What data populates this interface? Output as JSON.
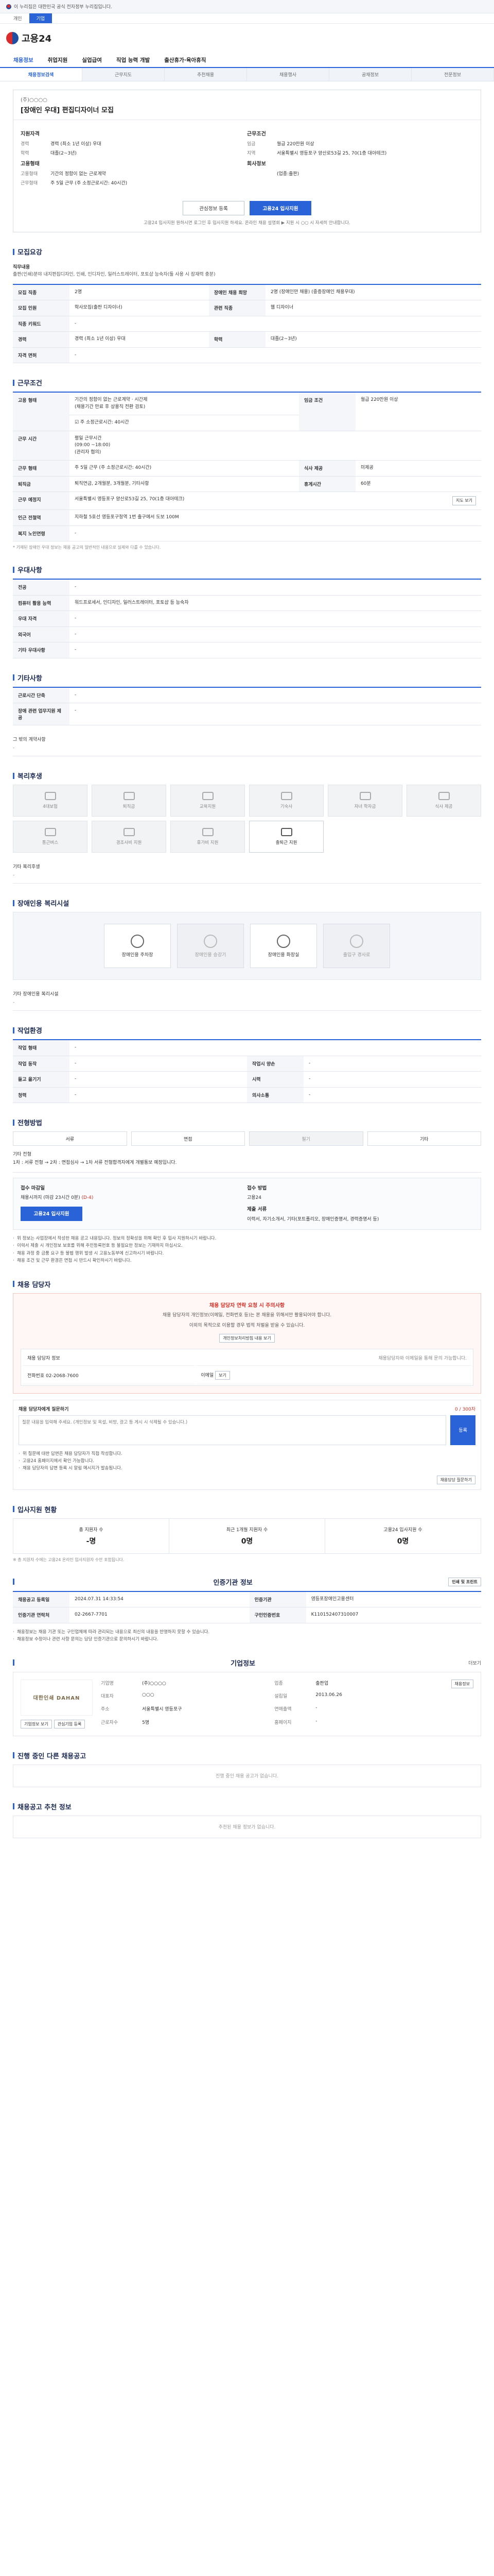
{
  "gov_bar": {
    "text": "이 누리집은 대한민국 공식 전자정부 누리집입니다."
  },
  "top_tabs": [
    "개인",
    "기업"
  ],
  "logo": {
    "text": "고용24"
  },
  "gnb": [
    "채용정보",
    "취업지원",
    "실업급여",
    "직업 능력 개발",
    "출산휴가·육아휴직"
  ],
  "subnav": [
    "채용정보검색",
    "근무지도",
    "추천채용",
    "채용행사",
    "공채정보",
    "전문정보"
  ],
  "job": {
    "company": "(주)○○○○",
    "title": "[장애인 우대] 편집디자이너 모집",
    "left_title": "지원자격",
    "left": [
      {
        "k": "경력",
        "v": "경력 (최소 1년 이상) 우대"
      },
      {
        "k": "학력",
        "v": "대졸(2~3년)"
      }
    ],
    "right_title": "근무조건",
    "right": [
      {
        "k": "임금",
        "v": "월급 220만원 이상"
      },
      {
        "k": "지역",
        "v": "서울특별시 영등포구 양산로53길 25, 70(1층 대아테크)"
      }
    ],
    "left_title2": "고용형태",
    "left2": [
      {
        "k": "고용형태",
        "v": "기간의 정함이 없는 근로계약"
      },
      {
        "k": "근무형태",
        "v": "주 5일 근무 (주 소정근로시간: 40시간)"
      }
    ],
    "right_title2": "회사정보",
    "right2": [
      {
        "k": "",
        "v": "(업종:출판)"
      }
    ],
    "btn_scrap": "관심정보 등록",
    "btn_apply": "고용24 입사지원",
    "notice": "고용24 입사지원 원하시면 로그인 후 입사지원 하세요. 온라인 채용 설명회 ▶ 지원 시 ○○ 시 자세히 안내합니다."
  },
  "recruit": {
    "title": "모집요강",
    "desc_head": "직무내용",
    "desc": "출판(인쇄)분야 내지편집디자인, 인쇄, 인디자인, 일러스트레이터, 포토샵 능숙자(툴 사용 시 잠재력 충분)",
    "rows": [
      [
        "모집 직종",
        "2명",
        "장애인 채용 희망",
        "2명 (장애인만 채용) (중증장애인 채용우대)"
      ],
      [
        "모집 인원",
        "학사모집(출판 디자이너)",
        "관련 직종",
        "웹 디자이너"
      ],
      [
        "직종 키워드",
        "-",
        "",
        ""
      ],
      [
        "경력",
        "경력 (최소 1년 이상) 우대",
        "학력",
        "대졸(2~3년)"
      ],
      [
        "자격 면허",
        "-",
        "",
        ""
      ]
    ]
  },
  "conditions": {
    "title": "근무조건",
    "rows": [
      [
        "고용 형태",
        "기간의 정함이 없는 근로계약 · 시간제\n(채용기간 만료 후 상용직 전환 검토)",
        "임금 조건",
        "월급 220만원 이상"
      ],
      [
        "",
        "☑ 주 소정근로시간: 40시간",
        "",
        ""
      ],
      [
        "근무 시간",
        "평일 근무시간\n(09:00 ~18:00)\n(관리자 협의)",
        "",
        ""
      ],
      [
        "퇴직금",
        "퇴직연금, 2개월분, 3개월분, 기타사항",
        "휴게시간",
        "60분"
      ],
      [
        "근무 예정지",
        "서울특별시 영등포구 양산로53길 25, 70(1층 대아테크)",
        "",
        ""
      ],
      [
        "인근 전철역",
        "지하철 5호선 영등포구청역 1번 출구에서 도보 100M",
        "",
        ""
      ],
      [
        "복지 노인연령",
        "-",
        "",
        ""
      ]
    ],
    "sub_rows": [
      [
        "근무 형태",
        "주 5일 근무 (주 소정근로시간: 40시간)",
        "식사 제공",
        "미제공"
      ]
    ],
    "note": "* 기재된 장애인 우대 정보는 채용 공고의 일반적인 내용으로 실제와 다를 수 있습니다.",
    "map_btn": "지도 보기"
  },
  "qual": {
    "title": "우대사항",
    "rows": [
      [
        "전공",
        "-"
      ],
      [
        "컴퓨터 활용 능력",
        "워드프로세서, 인디자인, 일러스트레이터, 포토샵 등 능숙자"
      ],
      [
        "우대 자격",
        "-"
      ],
      [
        "외국어",
        "-"
      ],
      [
        "기타 우대사항",
        "-"
      ]
    ]
  },
  "etc": {
    "title": "기타사항",
    "rows": [
      [
        "근로시간 단축",
        "-"
      ],
      [
        "장애 관련 업무지원 제공",
        "-"
      ]
    ],
    "extra_title": "그 밖의 계약사항",
    "extra_value": "-"
  },
  "welfare": {
    "title": "복리후생",
    "items": [
      "4대보험",
      "퇴직금",
      "교육지원",
      "기숙사",
      "자녀 학자금",
      "식사 제공",
      "통근버스",
      "경조사비 지원",
      "휴가비 지원",
      "출퇴근 지원",
      "주차 가능",
      "연차 제도"
    ],
    "on_index": [
      9
    ],
    "note_label": "기타 복리후생",
    "note_value": "-"
  },
  "disability": {
    "title": "장애인용 복리시설",
    "items": [
      "장애인용 주차장",
      "장애인용 승강기",
      "장애인용 화장실",
      "출입구 경사로"
    ],
    "on": [
      true,
      false,
      true,
      false
    ],
    "note_label": "기타 장애인용 복리시설",
    "note_value": "-"
  },
  "env": {
    "title": "작업환경",
    "rows": [
      [
        "작업 형태",
        "-",
        "",
        ""
      ],
      [
        "작업 동작",
        "-",
        "작업시 양손",
        "-"
      ],
      [
        "들고 옮기기",
        "-",
        "시력",
        "-"
      ],
      [
        "청력",
        "-",
        "의사소통",
        "-"
      ]
    ]
  },
  "method": {
    "title": "전형방법",
    "items": [
      "서류",
      "면접",
      "필기",
      "기타"
    ],
    "off": [
      false,
      false,
      true,
      false
    ],
    "info_title": "기타 전형",
    "info": "1차 : 서류 전형 → 2차 : 면접심사 → 1차 서류 전형합격자에게 개별통보 예정입니다.",
    "recv_title": "접수 마감일",
    "recv_value": "채용시까지 (마감 23시간 0분)",
    "recv_value2": "(D-4)",
    "recv_way_title": "접수 방법",
    "recv_way": "고용24",
    "doc_title": "제출 서류",
    "doc_value": "이력서, 자기소개서, 기타(포트폴리오, 장애인증명서, 경력증명서 등)",
    "apply_btn": "고용24 입사지원",
    "notes": [
      "위 정보는 사업장에서 작성한 채용 공고 내용입니다. 정보의 정확성을 위해 확인 후 입사 지원하시기 바랍니다.",
      "이력서 제출 시 개인정보 보호를 위해 주민등록번호 등 불필요한 정보는 기재하지 마십시오.",
      "채용 과정 중 금품 요구 등 불법 행위 발생 시 고용노동부에 신고하시기 바랍니다.",
      "채용 조건 및 근무 환경은 면접 시 반드시 확인하시기 바랍니다."
    ]
  },
  "contact": {
    "title": "채용 담당자",
    "warn": "채용 담당자 연락 요청 시 주의사항",
    "desc": "채용 담당자의 개인정보(이메일, 전화번호 등)는 본 채용을 위해서만 활용되어야 합니다.",
    "desc2": "이외의 목적으로 이용할 경우 법적 처벌을 받을 수 있습니다.",
    "btn": "개인정보처리방침 내용 보기",
    "tag": "채용 담당자 정보",
    "phone_label": "전화번호",
    "phone": "02-2068-7600",
    "email_label": "이메일",
    "email_btn": "보기",
    "right_note": "채용담당자와 이메일을 통해 문의 가능합니다.",
    "qa_title": "채용 담당자에게 질문하기",
    "qa_limit": "0 / 300자",
    "qa_placeholder": "질문 내용을 입력해 주세요. (개인정보 및 욕설, 비방, 광고 등 게시 시 삭제될 수 있습니다.)",
    "qa_send": "등록",
    "qa_notes": [
      "위 질문에 대한 답변은 채용 담당자가 직접 작성합니다.",
      "고용24 홈페이지에서 확인 가능합니다.",
      "채용 담당자의 답변 등록 시 알림 메시지가 발송됩니다."
    ],
    "qa_btn": "채용담당 질문하기"
  },
  "status": {
    "title": "입사지원 현황",
    "cells": [
      {
        "label": "총 지원자 수",
        "n": "-명"
      },
      {
        "label": "최근 1개월 지원자 수",
        "n": "0명"
      },
      {
        "label": "고용24 입사지원 수",
        "n": "0명"
      }
    ],
    "note": "※ 총 지원자 수에는 고용24 온라인 입사지원자 수만 포함됩니다."
  },
  "info": {
    "title": "인증기관 정보",
    "print_btn": "인쇄 및 프린트",
    "rows": [
      [
        "채용공고 등록일",
        "2024.07.31 14:33:54",
        "인증기관",
        "영등포장애인고용센터"
      ],
      [
        "인증기관 연락처",
        "02-2667-7701",
        "구인인증번호",
        "K110152407310007"
      ]
    ],
    "notes": [
      "채용정보는 채용 기관 또는 구인업체에 따라 관리되는 내용으로 최신의 내용을 반영하지 못할 수 있습니다.",
      "채용정보 수정이나 관련 사항 문의는 담당 인증기관으로 문의하시기 바랍니다."
    ]
  },
  "company": {
    "title": "기업정보",
    "more": "더보기",
    "logo_text": "대한인쇄 DAHAN",
    "rows": [
      [
        "기업명",
        "(주)○○○○",
        "업종",
        "출판업"
      ],
      [
        "대표자",
        "○○○",
        "설립일",
        "2013.06.26"
      ],
      [
        "주소",
        "서울특별시 영등포구",
        "연매출액",
        "-"
      ],
      [
        "근로자수",
        "5명",
        "홈페이지",
        "-"
      ]
    ],
    "btn1": "기업정보 보기",
    "btn2": "관심기업 등록",
    "btn3": "채용정보"
  },
  "other_jobs": {
    "title": "진행 중인 다른 채용공고",
    "empty": "진행 중인 채용 공고가 없습니다."
  },
  "recent": {
    "title": "채용공고 추천 정보",
    "empty": "추천된 채용 정보가 없습니다."
  }
}
